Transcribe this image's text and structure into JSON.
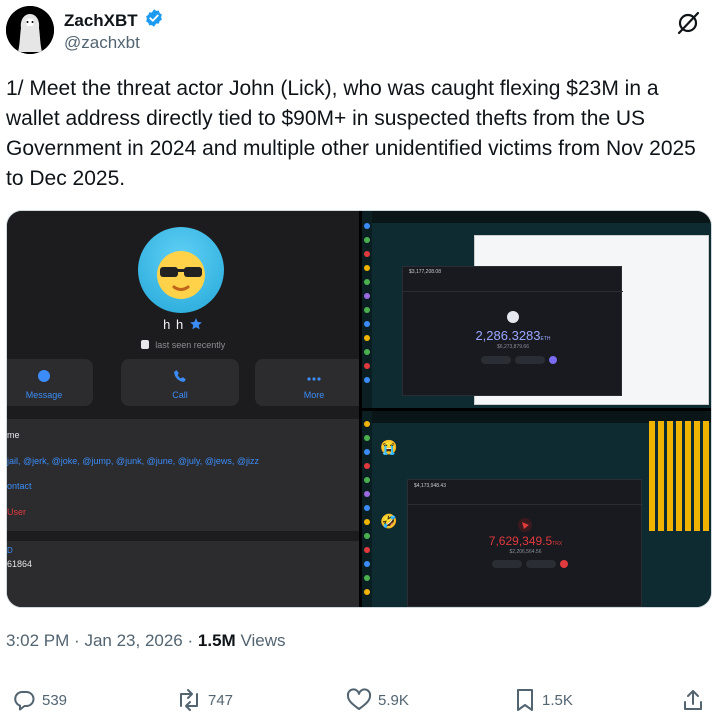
{
  "author": {
    "name": "ZachXBT",
    "handle": "@zachxbt",
    "verified": true
  },
  "tweet": {
    "text": "1/ Meet the threat actor John (Lick), who was caught flexing $23M in a wallet address directly tied to $90M+  in suspected thefts from the US Government in 2024 and multiple other unidentified victims from Nov 2025 to Dec 2025."
  },
  "media": {
    "profile": {
      "display_name": "h h",
      "status": "last seen recently",
      "buttons": [
        "Message",
        "Call",
        "More"
      ],
      "rows": {
        "row1": "me",
        "row2": "jail, @jerk, @joke, @jump, @junk, @june, @july, @jews, @jizz",
        "row3": "ontact",
        "row4": "User",
        "row5a": "D",
        "row5b": "61864"
      }
    },
    "screenshot_a": {
      "balance": "2,286.3283",
      "unit": "ETH",
      "sub": "$6,273,879.66",
      "header": "$3,177,208.08"
    },
    "screenshot_b": {
      "balance": "7,629,349.5",
      "unit": "TRX",
      "sub": "$2,206,564.56",
      "header": "$4,173,948.43"
    }
  },
  "meta": {
    "time": "3:02 PM",
    "sep1": "·",
    "date": "Jan 23, 2026",
    "sep2": "·",
    "views_count": "1.5M",
    "views_label": "Views"
  },
  "actions": {
    "replies": "539",
    "reposts": "747",
    "likes": "5.9K",
    "bookmarks": "1.5K"
  },
  "colors": {
    "verified": "#1d9bf0",
    "muted": "#536471",
    "tg_link": "#3b8cf7",
    "tg_bg": "#1c1c1e",
    "warn": "#e0393e"
  }
}
